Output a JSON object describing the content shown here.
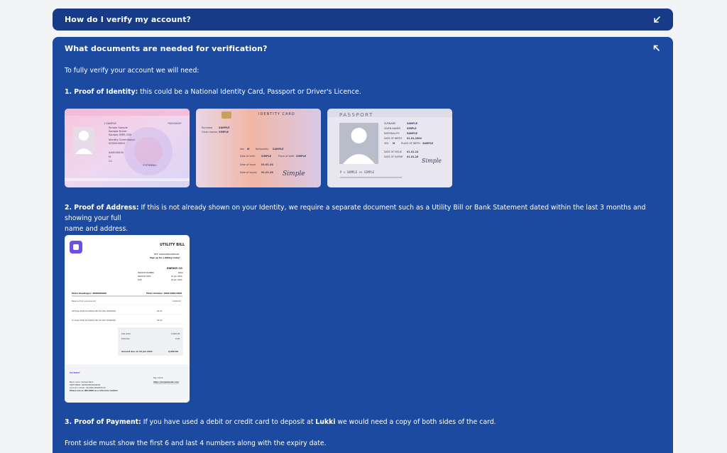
{
  "faq": {
    "collapsed_question": "How do I verify my account?",
    "open_question": "What documents are needed for verification?",
    "intro": "To fully verify your account we will need:",
    "proof_identity": {
      "title": "1. Proof of Identity:",
      "text": " this could be a National Identity Card, Passport or Driver's Licence."
    },
    "proof_address": {
      "title": "2. Proof of Address:",
      "text_line1": " If this is not already shown on your Identity, we require a separate document such as a Utility Bill or Bank Statement dated within the last 3 months and showing your full",
      "text_line2": "name and address."
    },
    "proof_payment": {
      "title": "3. Proof of Payment:",
      "text_before": " If you have used a debit or credit card to deposit at ",
      "brand": "Lukki",
      "text_after": " we would need a copy of both sides of the card."
    },
    "front_side": "Front side must show the first 6 and last 4 numbers along with the expiry date."
  },
  "driver_licence": {
    "lines": [
      "1  SAMPLE",
      "Simple Sample",
      "Sample Driver",
      "Sample SMPL 000",
      "Identity Commission",
      "0000000000",
      "*0000000*",
      "AA0000000",
      "M",
      "CC",
      "YYYYMM00"
    ]
  },
  "identity_card": {
    "title": "IDENTITY CARD",
    "surname_label": "Surname",
    "surname": "SAMPLE",
    "given_label": "Given names",
    "given": "SIMPLE",
    "sex_label": "Sex",
    "sex": "M",
    "nat_label": "Nationality",
    "nat": "SAMPLE",
    "dob_label": "Date of birth",
    "dob": "SIMPLE",
    "pob_label": "Place of birth",
    "pob": "SIMPLE",
    "doi_label": "Date of issue",
    "doi": "01.01.24",
    "doe_label": "Date of expiry",
    "doe": "01.01.26",
    "signature": "Simple"
  },
  "passport": {
    "title": "PASSPORT",
    "fields": [
      {
        "label": "SURNAME",
        "value": "SAMPLE"
      },
      {
        "label": "GIVEN NAMES",
        "value": "SIMPLE"
      },
      {
        "label": "NATIONALITY",
        "value": "SAMPLE"
      },
      {
        "label": "DATE OF BIRTH",
        "value": "01.01.2000"
      },
      {
        "label": "SEX",
        "value": "M"
      },
      {
        "label": "PLACE OF BIRTH",
        "value": "SAMPLE"
      },
      {
        "label": "DATE OF ISSUE",
        "value": "01.01.24"
      },
      {
        "label": "DATE OF EXPIRY",
        "value": "01.01.26"
      }
    ],
    "mrz1": "P < SAMPLE << SIMPLE",
    "mrz2": "<<<<<<<<<<<<<<<<<<<<<<<<<<<<<<<<<<<<<<<<<<<<",
    "signature": "Simple"
  },
  "utility_bill": {
    "title": "UTILITY BILL",
    "ref": "REF: 0000000000000000",
    "signup": "Sign up for e-Billing today!",
    "company": "ENERGY CO",
    "invoice_number_label": "INVOICE NUMBER",
    "invoice_number": "0000",
    "invoice_date_label": "INVOICE DATE",
    "invoice_date": "01 Jan 2024",
    "due_label": "DUE",
    "due": "20 Jan 2024",
    "account_label": "Meter Reading(s): 0000000000",
    "meter_label": "Meter Number: 0000 0000 0000",
    "rows": [
      {
        "desc": "Balance from previous bill",
        "amt": "0,000.00"
      },
      {
        "desc": "Off Peak 0000 $0.00000 kWh $0.000 (0000000)",
        "amt": "00.00"
      },
      {
        "desc": "On Peak 0000 $0.00000 kWh $0.000 (0000000)",
        "amt": "00.00"
      }
    ],
    "subtotal_label": "Sub total",
    "subtotal": "0,000.00",
    "tax_label": "Total tax",
    "tax": "0.00",
    "amount_due_label": "Amount due on 20 Jan 2023",
    "amount_due": "0,000.00",
    "payment_label": "PAYMENT",
    "bank_lines": [
      "Bank name: Sample Bank",
      "SWIFT/IBAN: 0000000000000000",
      "Account number: 00-0000-0000000-00",
      "Please use as INV-0000 as a reference number"
    ],
    "pay_online": "Pay online",
    "pay_url": "https://samplebank.com/"
  },
  "colors": {
    "page_bg": "#f3f4f6",
    "collapsed_bg": "#173b86",
    "open_bg": "#1c4aa0",
    "text": "#ffffff",
    "bill_accent": "#6d4ee8"
  },
  "icons": {
    "collapsed_toggle": "arrow-down-left-icon",
    "open_toggle": "arrow-up-left-icon"
  }
}
